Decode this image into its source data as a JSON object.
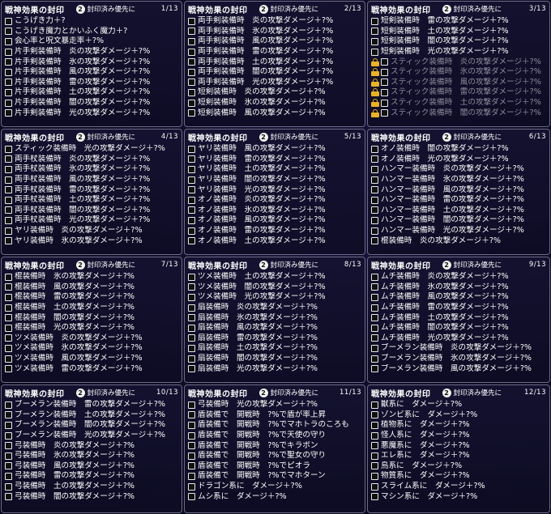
{
  "title": "戦神効果の封印",
  "sort_button_icon": "2",
  "sort_label": "封印済み優先に",
  "panels": [
    {
      "page": "1/13",
      "rows": [
        {
          "text": "こうげき力＋?",
          "locked": false
        },
        {
          "text": "こうげき魔力とかいふく魔力＋?",
          "locked": false
        },
        {
          "text": "会心率と呪文暴走率＋?%",
          "locked": false
        },
        {
          "text": "片手剣装備時　炎の攻撃ダメージ＋?%",
          "locked": false
        },
        {
          "text": "片手剣装備時　氷の攻撃ダメージ＋?%",
          "locked": false
        },
        {
          "text": "片手剣装備時　風の攻撃ダメージ＋?%",
          "locked": false
        },
        {
          "text": "片手剣装備時　雷の攻撃ダメージ＋?%",
          "locked": false
        },
        {
          "text": "片手剣装備時　土の攻撃ダメージ＋?%",
          "locked": false
        },
        {
          "text": "片手剣装備時　闇の攻撃ダメージ＋?%",
          "locked": false
        },
        {
          "text": "片手剣装備時　光の攻撃ダメージ＋?%",
          "locked": false
        }
      ]
    },
    {
      "page": "2/13",
      "rows": [
        {
          "text": "両手剣装備時　炎の攻撃ダメージ＋?%",
          "locked": false
        },
        {
          "text": "両手剣装備時　氷の攻撃ダメージ＋?%",
          "locked": false
        },
        {
          "text": "両手剣装備時　風の攻撃ダメージ＋?%",
          "locked": false
        },
        {
          "text": "両手剣装備時　雷の攻撃ダメージ＋?%",
          "locked": false
        },
        {
          "text": "両手剣装備時　土の攻撃ダメージ＋?%",
          "locked": false
        },
        {
          "text": "両手剣装備時　闇の攻撃ダメージ＋?%",
          "locked": false
        },
        {
          "text": "両手剣装備時　光の攻撃ダメージ＋?%",
          "locked": false
        },
        {
          "text": "短剣装備時　炎の攻撃ダメージ＋?%",
          "locked": false
        },
        {
          "text": "短剣装備時　氷の攻撃ダメージ＋?%",
          "locked": false
        },
        {
          "text": "短剣装備時　風の攻撃ダメージ＋?%",
          "locked": false
        }
      ]
    },
    {
      "page": "3/13",
      "rows": [
        {
          "text": "短剣装備時　雷の攻撃ダメージ＋?%",
          "locked": false
        },
        {
          "text": "短剣装備時　土の攻撃ダメージ＋?%",
          "locked": false
        },
        {
          "text": "短剣装備時　闇の攻撃ダメージ＋?%",
          "locked": false
        },
        {
          "text": "短剣装備時　光の攻撃ダメージ＋?%",
          "locked": false
        },
        {
          "text": "スティック装備時　炎の攻撃ダメージ＋?%",
          "locked": true
        },
        {
          "text": "スティック装備時　氷の攻撃ダメージ＋?%",
          "locked": true
        },
        {
          "text": "スティック装備時　風の攻撃ダメージ＋?%",
          "locked": true
        },
        {
          "text": "スティック装備時　雷の攻撃ダメージ＋?%",
          "locked": true
        },
        {
          "text": "スティック装備時　土の攻撃ダメージ＋?%",
          "locked": true
        },
        {
          "text": "スティック装備時　闇の攻撃ダメージ＋?%",
          "locked": true
        }
      ]
    },
    {
      "page": "4/13",
      "rows": [
        {
          "text": "スティック装備時　光の攻撃ダメージ＋?%",
          "locked": false
        },
        {
          "text": "両手杖装備時　炎の攻撃ダメージ＋?%",
          "locked": false
        },
        {
          "text": "両手杖装備時　氷の攻撃ダメージ＋?%",
          "locked": false
        },
        {
          "text": "両手杖装備時　風の攻撃ダメージ＋?%",
          "locked": false
        },
        {
          "text": "両手杖装備時　雷の攻撃ダメージ＋?%",
          "locked": false
        },
        {
          "text": "両手杖装備時　土の攻撃ダメージ＋?%",
          "locked": false
        },
        {
          "text": "両手杖装備時　闇の攻撃ダメージ＋?%",
          "locked": false
        },
        {
          "text": "両手杖装備時　光の攻撃ダメージ＋?%",
          "locked": false
        },
        {
          "text": "ヤリ装備時　炎の攻撃ダメージ＋?%",
          "locked": false
        },
        {
          "text": "ヤリ装備時　氷の攻撃ダメージ＋?%",
          "locked": false
        }
      ]
    },
    {
      "page": "5/13",
      "rows": [
        {
          "text": "ヤリ装備時　風の攻撃ダメージ＋?%",
          "locked": false
        },
        {
          "text": "ヤリ装備時　雷の攻撃ダメージ＋?%",
          "locked": false
        },
        {
          "text": "ヤリ装備時　土の攻撃ダメージ＋?%",
          "locked": false
        },
        {
          "text": "ヤリ装備時　闇の攻撃ダメージ＋?%",
          "locked": false
        },
        {
          "text": "ヤリ装備時　光の攻撃ダメージ＋?%",
          "locked": false
        },
        {
          "text": "オノ装備時　炎の攻撃ダメージ＋?%",
          "locked": false
        },
        {
          "text": "オノ装備時　氷の攻撃ダメージ＋?%",
          "locked": false
        },
        {
          "text": "オノ装備時　風の攻撃ダメージ＋?%",
          "locked": false
        },
        {
          "text": "オノ装備時　雷の攻撃ダメージ＋?%",
          "locked": false
        },
        {
          "text": "オノ装備時　土の攻撃ダメージ＋?%",
          "locked": false
        }
      ]
    },
    {
      "page": "6/13",
      "rows": [
        {
          "text": "オノ装備時　闇の攻撃ダメージ＋?%",
          "locked": false
        },
        {
          "text": "オノ装備時　光の攻撃ダメージ＋?%",
          "locked": false
        },
        {
          "text": "ハンマー装備時　炎の攻撃ダメージ＋?%",
          "locked": false
        },
        {
          "text": "ハンマー装備時　氷の攻撃ダメージ＋?%",
          "locked": false
        },
        {
          "text": "ハンマー装備時　風の攻撃ダメージ＋?%",
          "locked": false
        },
        {
          "text": "ハンマー装備時　雷の攻撃ダメージ＋?%",
          "locked": false
        },
        {
          "text": "ハンマー装備時　土の攻撃ダメージ＋?%",
          "locked": false
        },
        {
          "text": "ハンマー装備時　闇の攻撃ダメージ＋?%",
          "locked": false
        },
        {
          "text": "ハンマー装備時　光の攻撃ダメージ＋?%",
          "locked": false
        },
        {
          "text": "棍装備時　炎の攻撃ダメージ＋?%",
          "locked": false
        }
      ]
    },
    {
      "page": "7/13",
      "rows": [
        {
          "text": "棍装備時　氷の攻撃ダメージ＋?%",
          "locked": false
        },
        {
          "text": "棍装備時　風の攻撃ダメージ＋?%",
          "locked": false
        },
        {
          "text": "棍装備時　雷の攻撃ダメージ＋?%",
          "locked": false
        },
        {
          "text": "棍装備時　土の攻撃ダメージ＋?%",
          "locked": false
        },
        {
          "text": "棍装備時　闇の攻撃ダメージ＋?%",
          "locked": false
        },
        {
          "text": "棍装備時　光の攻撃ダメージ＋?%",
          "locked": false
        },
        {
          "text": "ツメ装備時　炎の攻撃ダメージ＋?%",
          "locked": false
        },
        {
          "text": "ツメ装備時　氷の攻撃ダメージ＋?%",
          "locked": false
        },
        {
          "text": "ツメ装備時　風の攻撃ダメージ＋?%",
          "locked": false
        },
        {
          "text": "ツメ装備時　雷の攻撃ダメージ＋?%",
          "locked": false
        }
      ]
    },
    {
      "page": "8/13",
      "rows": [
        {
          "text": "ツメ装備時　土の攻撃ダメージ＋?%",
          "locked": false
        },
        {
          "text": "ツメ装備時　闇の攻撃ダメージ＋?%",
          "locked": false
        },
        {
          "text": "ツメ装備時　光の攻撃ダメージ＋?%",
          "locked": false
        },
        {
          "text": "扇装備時　炎の攻撃ダメージ＋?%",
          "locked": false
        },
        {
          "text": "扇装備時　氷の攻撃ダメージ＋?%",
          "locked": false
        },
        {
          "text": "扇装備時　風の攻撃ダメージ＋?%",
          "locked": false
        },
        {
          "text": "扇装備時　雷の攻撃ダメージ＋?%",
          "locked": false
        },
        {
          "text": "扇装備時　土の攻撃ダメージ＋?%",
          "locked": false
        },
        {
          "text": "扇装備時　闇の攻撃ダメージ＋?%",
          "locked": false
        },
        {
          "text": "扇装備時　光の攻撃ダメージ＋?%",
          "locked": false
        }
      ]
    },
    {
      "page": "9/13",
      "rows": [
        {
          "text": "ムチ装備時　炎の攻撃ダメージ＋?%",
          "locked": false
        },
        {
          "text": "ムチ装備時　氷の攻撃ダメージ＋?%",
          "locked": false
        },
        {
          "text": "ムチ装備時　風の攻撃ダメージ＋?%",
          "locked": false
        },
        {
          "text": "ムチ装備時　雷の攻撃ダメージ＋?%",
          "locked": false
        },
        {
          "text": "ムチ装備時　土の攻撃ダメージ＋?%",
          "locked": false
        },
        {
          "text": "ムチ装備時　闇の攻撃ダメージ＋?%",
          "locked": false
        },
        {
          "text": "ムチ装備時　光の攻撃ダメージ＋?%",
          "locked": false
        },
        {
          "text": "ブーメラン装備時　炎の攻撃ダメージ＋?%",
          "locked": false
        },
        {
          "text": "ブーメラン装備時　氷の攻撃ダメージ＋?%",
          "locked": false
        },
        {
          "text": "ブーメラン装備時　風の攻撃ダメージ＋?%",
          "locked": false
        }
      ]
    },
    {
      "page": "10/13",
      "rows": [
        {
          "text": "ブーメラン装備時　雷の攻撃ダメージ＋?%",
          "locked": false
        },
        {
          "text": "ブーメラン装備時　土の攻撃ダメージ＋?%",
          "locked": false
        },
        {
          "text": "ブーメラン装備時　闇の攻撃ダメージ＋?%",
          "locked": false
        },
        {
          "text": "ブーメラン装備時　光の攻撃ダメージ＋?%",
          "locked": false
        },
        {
          "text": "弓装備時　炎の攻撃ダメージ＋?%",
          "locked": false
        },
        {
          "text": "弓装備時　氷の攻撃ダメージ＋?%",
          "locked": false
        },
        {
          "text": "弓装備時　風の攻撃ダメージ＋?%",
          "locked": false
        },
        {
          "text": "弓装備時　雷の攻撃ダメージ＋?%",
          "locked": false
        },
        {
          "text": "弓装備時　土の攻撃ダメージ＋?%",
          "locked": false
        },
        {
          "text": "弓装備時　闇の攻撃ダメージ＋?%",
          "locked": false
        }
      ]
    },
    {
      "page": "11/13",
      "rows": [
        {
          "text": "弓装備時　光の攻撃ダメージ＋?%",
          "locked": false
        },
        {
          "text": "盾装備で　開戦時　?%で盾が率上昇",
          "locked": false
        },
        {
          "text": "盾装備で　開戦時　?%でマホトラのころも",
          "locked": false
        },
        {
          "text": "盾装備で　開戦時　?%で天使の守り",
          "locked": false
        },
        {
          "text": "盾装備で　開戦時　?%でキラポン",
          "locked": false
        },
        {
          "text": "盾装備で　開戦時　?%で聖女の守り",
          "locked": false
        },
        {
          "text": "盾装備で　開戦時　?%でピオラ",
          "locked": false
        },
        {
          "text": "盾装備で　開戦時　?%でマホターン",
          "locked": false
        },
        {
          "text": "ドラゴン系に　ダメージ＋?%",
          "locked": false
        },
        {
          "text": "ムシ系に　ダメージ＋?%",
          "locked": false
        }
      ]
    },
    {
      "page": "12/13",
      "rows": [
        {
          "text": "獣系に　ダメージ＋?%",
          "locked": false
        },
        {
          "text": "ゾンビ系に　ダメージ＋?%",
          "locked": false
        },
        {
          "text": "植物系に　ダメージ＋?%",
          "locked": false
        },
        {
          "text": "怪人系に　ダメージ＋?%",
          "locked": false
        },
        {
          "text": "悪魔系に　ダメージ＋?%",
          "locked": false
        },
        {
          "text": "エレ系に　ダメージ＋?%",
          "locked": false
        },
        {
          "text": "鳥系に　ダメージ＋?%",
          "locked": false
        },
        {
          "text": "物質系に　ダメージ＋?%",
          "locked": false
        },
        {
          "text": "スライム系に　ダメージ＋?%",
          "locked": false
        },
        {
          "text": "マシン系に　ダメージ＋?%",
          "locked": false
        }
      ]
    }
  ]
}
